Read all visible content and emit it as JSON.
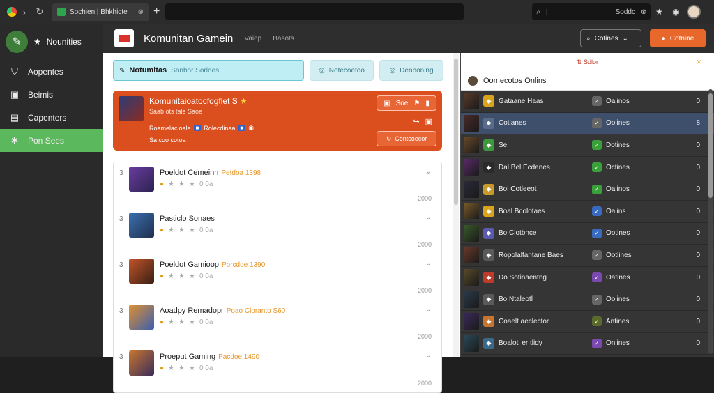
{
  "browser": {
    "tab_title": "Sochien | Bhkhicte",
    "search_value": "Soddc"
  },
  "sidebar": {
    "brand": "Nounities",
    "items": [
      {
        "label": "Aopentes",
        "icon": "shield-icon",
        "active": false
      },
      {
        "label": "Beimis",
        "icon": "gamepad-icon",
        "active": false
      },
      {
        "label": "Capenters",
        "icon": "grid-icon",
        "active": false
      },
      {
        "label": "Pon Sees",
        "icon": "puzzle-icon",
        "active": true
      }
    ]
  },
  "header": {
    "title": "Komunitan Gamein",
    "links": [
      "Vaiep",
      "Basots"
    ],
    "select_label": "Cotines",
    "action_label": "Cotnine"
  },
  "filters": {
    "primary_label": "Notumitas",
    "primary_sub": "Sonbor Sorlees",
    "tabs": [
      "Notecoetoo",
      "Denponing"
    ]
  },
  "featured": {
    "title": "Komunitaioatocfogflet S",
    "subtitle": "Saab ots tale Saoe",
    "meta_1": "Roamelacioale",
    "meta_2": "Rolecdinaa",
    "footer": "Sa coo cotoa",
    "action_top": "Soe",
    "action_button": "Contcoecor"
  },
  "list": [
    {
      "rank": "3",
      "name": "Poeldot Cemeinn",
      "tag": "Petdoa 1398",
      "score": "0 0a",
      "count": "2000",
      "colors": [
        "#6a3ca0",
        "#2c2350"
      ]
    },
    {
      "rank": "3",
      "name": "Pasticlo Sonaes",
      "tag": "",
      "score": "0 0a",
      "count": "2000",
      "colors": [
        "#3a6fb0",
        "#20304d"
      ]
    },
    {
      "rank": "3",
      "name": "Poeldot Gamioop",
      "tag": "Porcdoe 1390",
      "score": "0 0a",
      "count": "2000",
      "colors": [
        "#c2552a",
        "#3a1f14"
      ]
    },
    {
      "rank": "3",
      "name": "Aoadpy Remadopr",
      "tag": "Poao Cloranto S60",
      "score": "0 0a",
      "count": "2000",
      "colors": [
        "#e0902f",
        "#3b5fb0"
      ]
    },
    {
      "rank": "3",
      "name": "Proeput Gaming",
      "tag": "Pacdoe 1490",
      "score": "0 0a",
      "count": "2000",
      "colors": [
        "#c8762f",
        "#3a2c5a"
      ]
    }
  ],
  "right_panel": {
    "top_label": "Sdlor",
    "header": "Oomecotos Onlins",
    "rows": [
      {
        "name": "Gataane Haas",
        "status": "Oalinos",
        "num": "0",
        "icon_color": "#d9a31e",
        "status_color": "#666",
        "av": "#5a3a2a",
        "sel": false
      },
      {
        "name": "Cotlanes",
        "status": "Oolines",
        "num": "8",
        "icon_color": "#5a6a8a",
        "status_color": "#666",
        "av": "#4a2a2a",
        "sel": true
      },
      {
        "name": "Se",
        "status": "Dotines",
        "num": "0",
        "icon_color": "#3c9a3c",
        "status_color": "#3aa03a",
        "av": "#6a4a2a",
        "sel": false
      },
      {
        "name": "Dal Bel Ecdanes",
        "status": "Octines",
        "num": "0",
        "icon_color": "#2a2a2a",
        "status_color": "#3aa03a",
        "av": "#5a2a6a",
        "sel": false
      },
      {
        "name": "Bol Cotleeot",
        "status": "Oalinos",
        "num": "0",
        "icon_color": "#c89a2a",
        "status_color": "#3aa03a",
        "av": "#2a2a3a",
        "sel": false
      },
      {
        "name": "Boal Bcolotaes",
        "status": "Oalins",
        "num": "0",
        "icon_color": "#d9a31e",
        "status_color": "#3a6ac0",
        "av": "#7a5a2a",
        "sel": false
      },
      {
        "name": "Bo Clotbnce",
        "status": "Ootines",
        "num": "0",
        "icon_color": "#5a5ab0",
        "status_color": "#3a6ac0",
        "av": "#3a5a2a",
        "sel": false
      },
      {
        "name": "Ropolalfantane Baes",
        "status": "Ootlines",
        "num": "0",
        "icon_color": "#5a5a5a",
        "status_color": "#666",
        "av": "#6a3a2a",
        "sel": false
      },
      {
        "name": "Do Sotinaentng",
        "status": "Oatines",
        "num": "0",
        "icon_color": "#c03a2a",
        "status_color": "#7a4ab0",
        "av": "#5a4a2a",
        "sel": false
      },
      {
        "name": "Bo Ntaleotl",
        "status": "Oolines",
        "num": "0",
        "icon_color": "#5a5a5a",
        "status_color": "#666",
        "av": "#2a3a4a",
        "sel": false
      },
      {
        "name": "Coaelt aeclector",
        "status": "Antines",
        "num": "0",
        "icon_color": "#c8762f",
        "status_color": "#5a6a2a",
        "av": "#3a2a5a",
        "sel": false
      },
      {
        "name": "Boalotl er tlidy",
        "status": "Onlines",
        "num": "0",
        "icon_color": "#3a6a8a",
        "status_color": "#7a4ab0",
        "av": "#2a4a5a",
        "sel": false
      }
    ]
  }
}
